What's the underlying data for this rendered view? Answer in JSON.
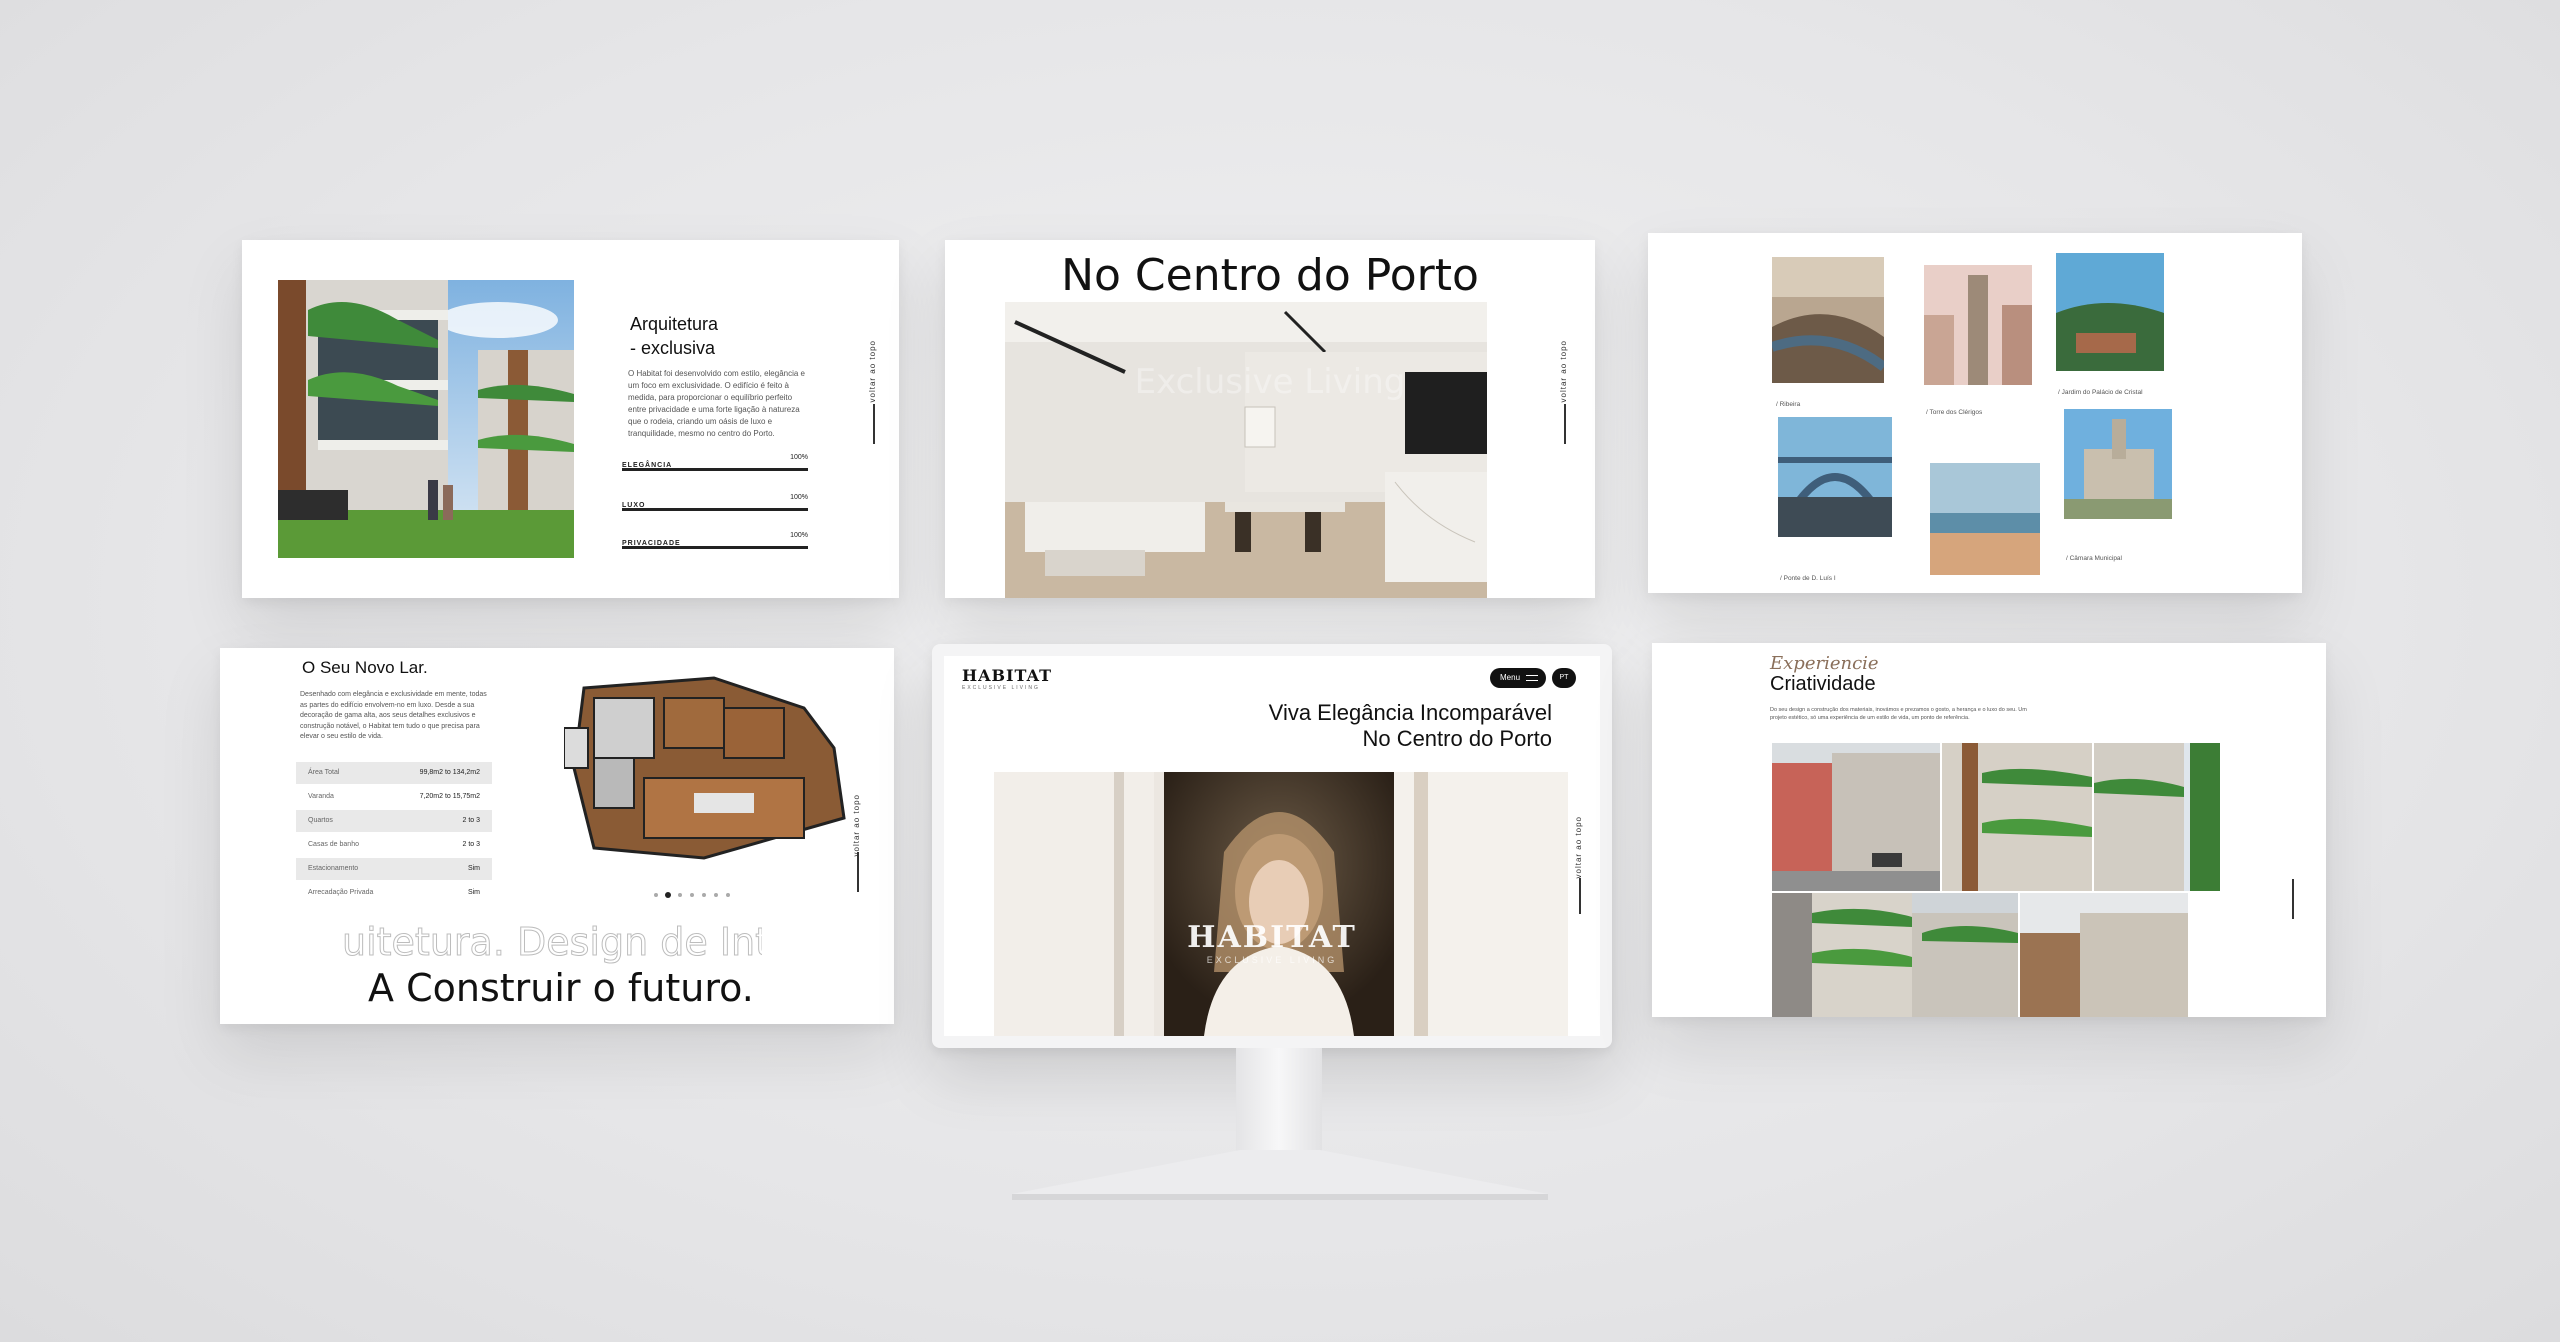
{
  "panel_a": {
    "title_line1": "Arquitetura",
    "title_line2": "- exclusiva",
    "body": "O Habitat foi desenvolvido com estilo, elegância e um foco em exclusividade. O edifício é feito à medida, para proporcionar o equilíbrio perfeito entre privacidade e uma forte ligação à natureza que o rodeia, criando um oásis de luxo e tranquilidade, mesmo no centro do Porto.",
    "bars": [
      {
        "label": "ELEGÂNCIA",
        "value": "100%"
      },
      {
        "label": "LUXO",
        "value": "100%"
      },
      {
        "label": "PRIVACIDADE",
        "value": "100%"
      }
    ],
    "scroll_label": "voltar ao topo"
  },
  "panel_b": {
    "title": "No Centro do Porto",
    "overlay": "Exclusive Living",
    "scroll_label": "voltar ao topo"
  },
  "panel_c": {
    "captions": [
      "/ Ribeira",
      "/ Torre dos Clérigos",
      "/ Jardim do Palácio de Cristal",
      "/ Ponte de D. Luís I",
      "/ Câmara Municipal"
    ]
  },
  "panel_d": {
    "title": "O Seu Novo Lar.",
    "body": "Desenhado com elegância e exclusividade em mente, todas as partes do edifício envolvem-no em luxo. Desde a sua decoração de gama alta, aos seus detalhes exclusivos e construção notável, o Habitat tem tudo o que precisa para elevar o seu estilo de vida.",
    "specs": [
      {
        "k": "Área Total",
        "v": "99,8m2 to 134,2m2"
      },
      {
        "k": "Varanda",
        "v": "7,20m2 to 15,75m2"
      },
      {
        "k": "Quartos",
        "v": "2 to 3"
      },
      {
        "k": "Casas de banho",
        "v": "2 to 3"
      },
      {
        "k": "Estacionamento",
        "v": "Sim"
      },
      {
        "k": "Arrecadação Privada",
        "v": "Sim"
      }
    ],
    "marquee": "uitetura. Design de Inte",
    "slogan": "A Construir o futuro.",
    "scroll_label": "voltar ao topo"
  },
  "panel_e": {
    "logo": "HABITAT",
    "logo_sub": "EXCLUSIVE LIVING",
    "menu_label": "Menu",
    "lang_label": "PT",
    "headline_line1": "Viva Elegância Incomparável",
    "headline_line2": "No Centro do Porto",
    "hero_logo": "HABITAT",
    "hero_sub": "EXCLUSIVE LIVING",
    "scroll_label": "voltar ao topo"
  },
  "panel_f": {
    "script_title": "Experiencie",
    "title": "Criatividade",
    "body": "Do seu design a construção dos materiais, inovámos e prezamos o gosto, a herança e o luxo do seu. Um projeto estético, só uma experiência de um estilo de vida, um ponto de referência.",
    "accent": "#8a6f5a"
  }
}
